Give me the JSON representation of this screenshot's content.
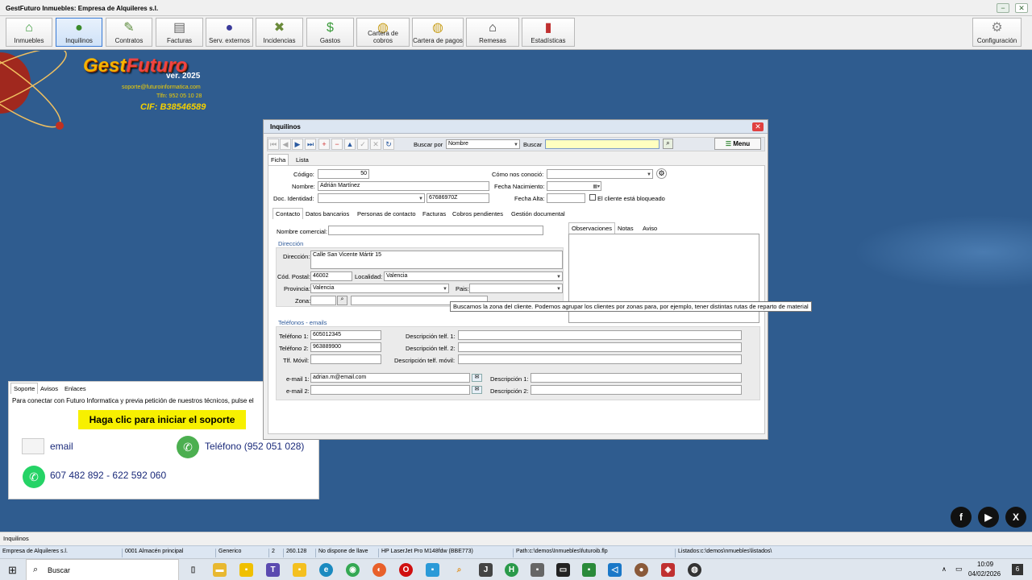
{
  "app": {
    "title": "GestFuturo Inmuebles: Empresa de Alquileres s.l.",
    "min": "−",
    "max": "▢",
    "close": "✕"
  },
  "toolbar": [
    {
      "label": "Inmuebles",
      "icon": "house-icon"
    },
    {
      "label": "Inquilinos",
      "icon": "person-icon"
    },
    {
      "label": "Contratos",
      "icon": "pen-icon"
    },
    {
      "label": "Facturas",
      "icon": "invoice-icon"
    },
    {
      "label": "Serv. externos",
      "icon": "worker-icon"
    },
    {
      "label": "Incidencias",
      "icon": "tools-icon"
    },
    {
      "label": "Gastos",
      "icon": "money-bag-icon"
    },
    {
      "label": "Cartera de cobros",
      "icon": "coins-icon"
    },
    {
      "label": "Cartera de pagos",
      "icon": "coins-stack-icon"
    },
    {
      "label": "Remesas",
      "icon": "bank-icon"
    },
    {
      "label": "Estadísticas",
      "icon": "bar-chart-icon"
    },
    {
      "label": "Configuración",
      "icon": "gear-icon"
    }
  ],
  "logo": {
    "brand_a": "Gest",
    "brand_b": "Futuro",
    "version": "ver. 2025",
    "email": "soporte@futuroinformatica.com",
    "phone": "Tlfn: 952 05 10 28",
    "cif": "CIF: B38546589"
  },
  "win": {
    "title": "Inquilinos",
    "buscar_por_label": "Buscar por",
    "buscar_por_value": "Nombre",
    "buscar_label": "Buscar",
    "menu_label": "Menu",
    "tabs": [
      "Ficha",
      "Lista"
    ],
    "codigo_label": "Código:",
    "codigo": "50",
    "nombre_label": "Nombre:",
    "nombre": "Adrián Martínez",
    "doc_label": "Doc. Identidad:",
    "doc_num": "67686970Z",
    "como_label": "Cómo nos conoció:",
    "fnac_label": "Fecha Nacimiento:",
    "falta_label": "Fecha Alta:",
    "bloqueado_label": "El cliente está bloqueado",
    "subtabs": [
      "Contacto",
      "Datos bancarios",
      "Personas de contacto",
      "Facturas",
      "Cobros pendientes",
      "Gestión documental"
    ],
    "nombre_comercial_label": "Nombre comercial:",
    "direccion_sec": "Dirección",
    "direccion_label": "Dirección:",
    "direccion": "Calle San Vicente Mártir 15",
    "cp_label": "Cód. Postal:",
    "cp": "46002",
    "localidad_label": "Localidad:",
    "localidad": "Valencia",
    "provincia_label": "Provincia:",
    "provincia": "Valencia",
    "pais_label": "Pais:",
    "zona_label": "Zona:",
    "obs_tabs": [
      "Observaciones",
      "Notas",
      "Aviso"
    ],
    "tel_sec": "Teléfonos - emails",
    "tel1_label": "Teléfono 1:",
    "tel1": "605012345",
    "tel2_label": "Teléfono 2:",
    "tel2": "963889900",
    "movil_label": "Tlf. Móvil:",
    "desc1_label": "Descripción telf. 1:",
    "desc2_label": "Descripción telf. 2:",
    "descm_label": "Descripción telf. móvil:",
    "email1_label": "e-mail 1:",
    "email1": "adrian.m@email.com",
    "email2_label": "e-mail 2:",
    "dese1_label": "Descripción 1:",
    "dese2_label": "Descripción 2:",
    "tooltip": "Buscamos la zona del cliente. Podemos agrupar los clientes por zonas para, por ejemplo, tener distintas rutas de reparto de material"
  },
  "support": {
    "tabs": [
      "Soporte",
      "Avisos",
      "Enlaces"
    ],
    "text": "Para conectar con Futuro Informatica y previa petición de nuestros técnicos, pulse el",
    "button": "Haga clic para iniciar el soporte",
    "email": "email",
    "phone": "Teléfono (952 051 028)",
    "whatsapp": "607 482 892 - 622 592 060"
  },
  "socials": [
    "f",
    "▶",
    "X"
  ],
  "status": {
    "module": "Inquilinos",
    "cells": [
      "Empresa de Alquileres s.l.",
      "0001 Almacén principal",
      "Generico",
      "2",
      "260.128",
      "No dispone de llave",
      "HP LaserJet Pro M148fdw (BBE773)",
      "Path:c:\\demos\\Inmuebles\\futuroib.flp",
      "Listados:c:\\demos\\nmuebles\\listados\\"
    ]
  },
  "taskbar": {
    "search": "Buscar",
    "time": "10:09",
    "date": "04/02/2026",
    "notif": "6"
  }
}
